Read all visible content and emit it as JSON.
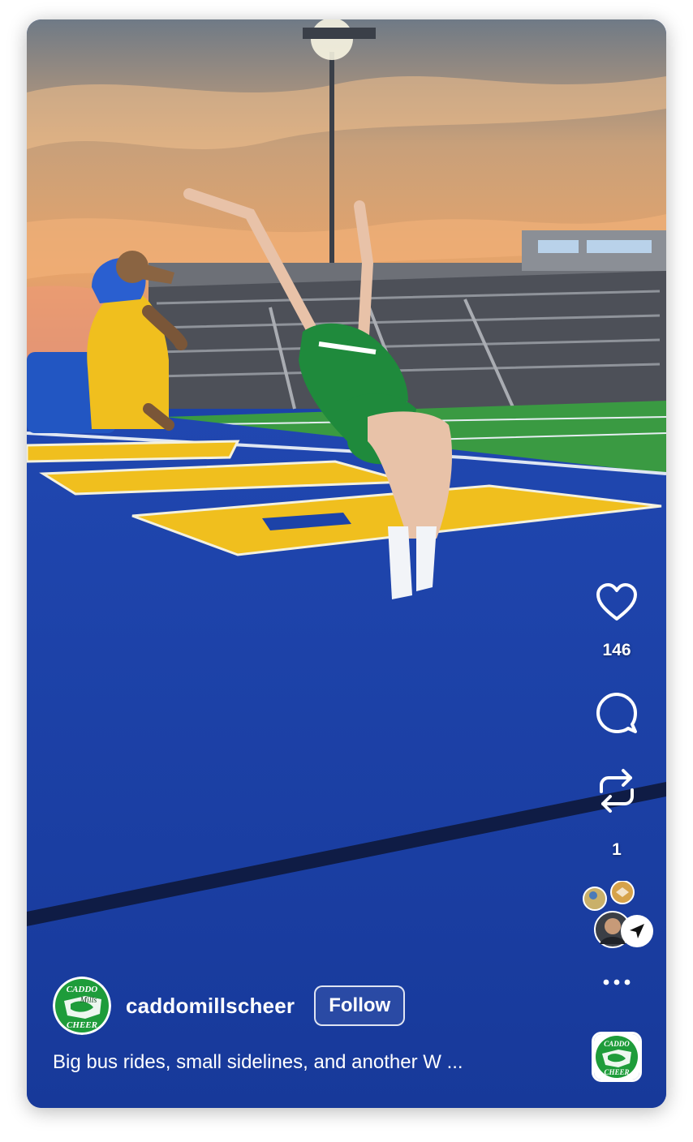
{
  "reel": {
    "likes_count": "146",
    "reposts_count": "1"
  },
  "owner": {
    "username": "caddomillscheer",
    "follow_label": "Follow",
    "logo_text_1": "CADDO",
    "logo_text_2": "Mills",
    "logo_text_3": "CHEER"
  },
  "caption": {
    "text": "Big bus rides, small sidelines, and another W ..."
  },
  "icons": {
    "like": "heart-icon",
    "comment": "comment-icon",
    "repost": "repost-icon",
    "share": "send-icon",
    "more": "more-icon"
  },
  "colors": {
    "turf": "#1c43a8",
    "endzone_letters": "#f0bf1e",
    "uniform": "#1f8a3c",
    "logo_green": "#1e9c3a"
  }
}
